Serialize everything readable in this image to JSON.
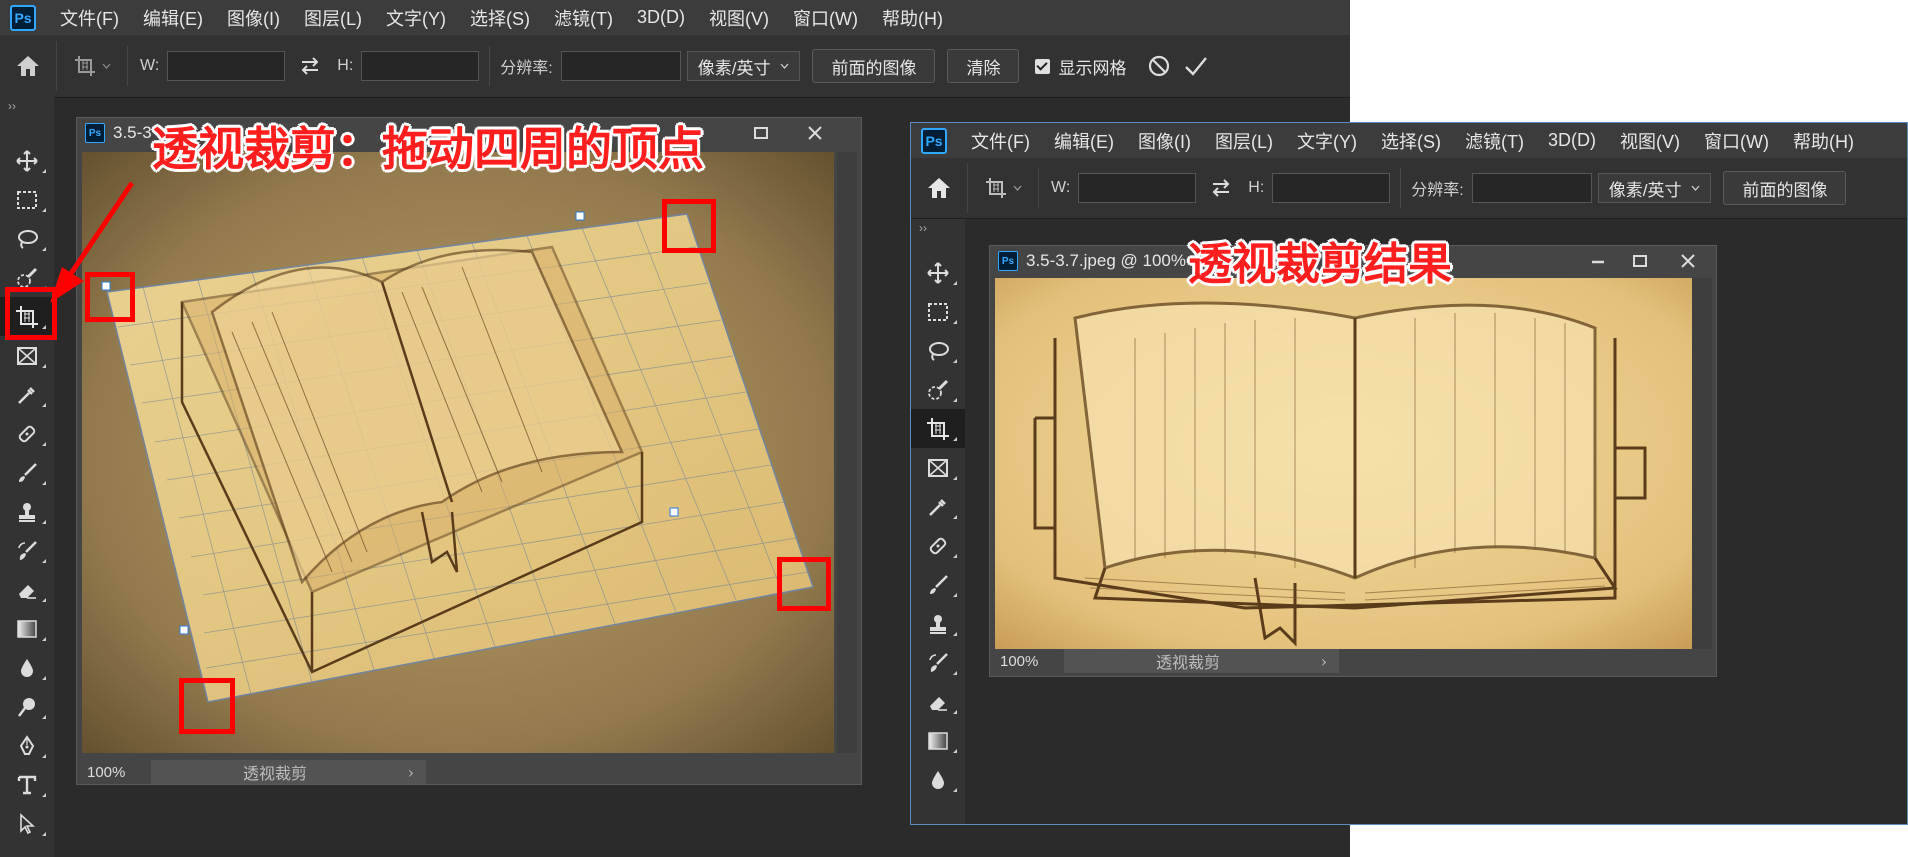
{
  "left_app": {
    "logo": "Ps",
    "menu": [
      "文件(F)",
      "编辑(E)",
      "图像(I)",
      "图层(L)",
      "文字(Y)",
      "选择(S)",
      "滤镜(T)",
      "3D(D)",
      "视图(V)",
      "窗口(W)",
      "帮助(H)"
    ],
    "options": {
      "w_label": "W:",
      "h_label": "H:",
      "resolution_label": "分辨率:",
      "unit_select": "像素/英寸",
      "front_image_button": "前面的图像",
      "clear_button": "清除",
      "show_grid_label": "显示网格",
      "show_grid_checked": true
    },
    "document": {
      "title": "3.5-3",
      "zoom": "100%",
      "status_info": "透视裁剪"
    }
  },
  "right_app": {
    "logo": "Ps",
    "menu": [
      "文件(F)",
      "编辑(E)",
      "图像(I)",
      "图层(L)",
      "文字(Y)",
      "选择(S)",
      "滤镜(T)",
      "3D(D)",
      "视图(V)",
      "窗口(W)",
      "帮助(H)"
    ],
    "options": {
      "w_label": "W:",
      "h_label": "H:",
      "resolution_label": "分辨率:",
      "unit_select": "像素/英寸",
      "front_image_button": "前面的图像"
    },
    "document": {
      "title": "3.5-3.7.jpeg @ 100%",
      "zoom": "100%",
      "status_info": "透视裁剪"
    }
  },
  "annotations": {
    "left": "透视裁剪：拖动四周的顶点",
    "right": "透视裁剪结果"
  },
  "colors": {
    "annotation_red": "#ff1e1e",
    "ps_blue": "#31a8ff",
    "panel_dark": "#2b2b2b"
  }
}
